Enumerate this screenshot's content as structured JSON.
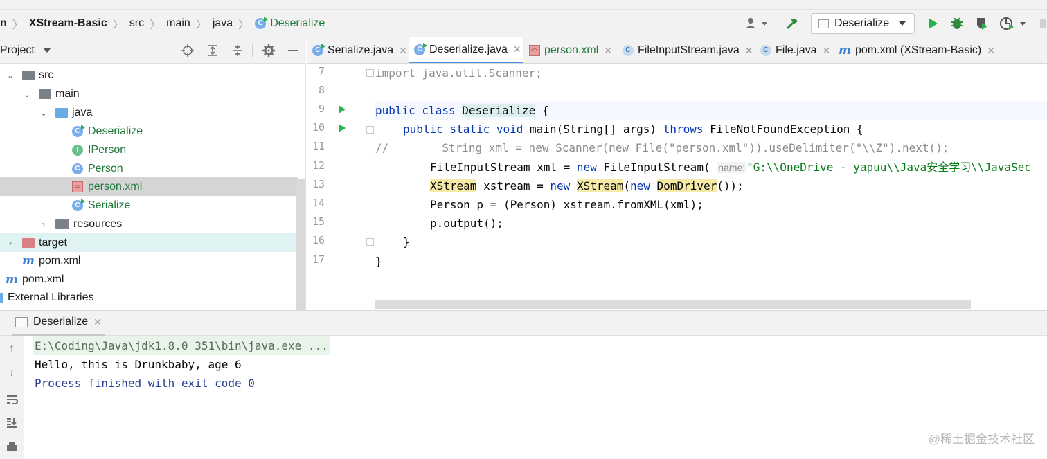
{
  "breadcrumb": {
    "items": [
      "n",
      "XStream-Basic",
      "src",
      "main",
      "java",
      "Deserialize"
    ]
  },
  "toolbar": {
    "run_config": "Deserialize",
    "icons": [
      "account-icon",
      "hammer-icon",
      "run-icon",
      "debug-icon",
      "coverage-icon",
      "profile-icon",
      "more-icon"
    ]
  },
  "project_panel": {
    "title": "Project",
    "tree": [
      {
        "label": "src"
      },
      {
        "label": "main"
      },
      {
        "label": "java"
      },
      {
        "label": "Deserialize"
      },
      {
        "label": "IPerson"
      },
      {
        "label": "Person"
      },
      {
        "label": "person.xml"
      },
      {
        "label": "Serialize"
      },
      {
        "label": "resources"
      },
      {
        "label": "target"
      },
      {
        "label": "pom.xml"
      },
      {
        "label": "pom.xml"
      },
      {
        "label": "External Libraries"
      }
    ]
  },
  "tabs": [
    {
      "label": "Serialize.java"
    },
    {
      "label": "Deserialize.java"
    },
    {
      "label": "person.xml"
    },
    {
      "label": "FileInputStream.java"
    },
    {
      "label": "File.java"
    },
    {
      "label": "pom.xml (XStream-Basic)"
    }
  ],
  "editor": {
    "line_numbers": [
      "7",
      "8",
      "9",
      "10",
      "11",
      "12",
      "13",
      "14",
      "15",
      "16",
      "17"
    ],
    "lines": {
      "l7": "import java.util.Scanner;",
      "l9_kw": "public class ",
      "l9_name": "Deserialize",
      "l9_end": " {",
      "l10_kw": "public static void ",
      "l10_mid": "main(String[] args) ",
      "l10_kw2": "throws ",
      "l10_end": "FileNotFoundException {",
      "l11": "//        String xml = new Scanner(new File(\"person.xml\")).useDelimiter(\"\\\\Z\").next();",
      "l12_a": "FileInputStream xml = ",
      "l12_new": "new ",
      "l12_b": "FileInputStream(",
      "l12_hint": "name:",
      "l12_str1": "\"G:\\\\OneDrive - ",
      "l12_str_ul": "yapuu",
      "l12_str2": "\\\\Java安全学习\\\\JavaSec",
      "l13_t1": "XStream",
      "l13_a": " xstream = ",
      "l13_new": "new ",
      "l13_t2": "XStream",
      "l13_b": "(",
      "l13_new2": "new ",
      "l13_t3": "DomDriver",
      "l13_c": "());",
      "l14": "Person p = (Person) xstream.fromXML(xml);",
      "l15": "p.output();",
      "l16": "}",
      "l17": "}"
    }
  },
  "run_panel": {
    "tab_label": "Deserialize",
    "console": [
      "E:\\Coding\\Java\\jdk1.8.0_351\\bin\\java.exe ...",
      "Hello, this is Drunkbaby, age 6",
      "Process finished with exit code 0"
    ]
  },
  "watermark": "@稀土掘金技术社区",
  "colors": {
    "accent": "#4a8fe2",
    "run_green": "#2bb04a",
    "keyword": "#0033b3",
    "string": "#067d17"
  }
}
